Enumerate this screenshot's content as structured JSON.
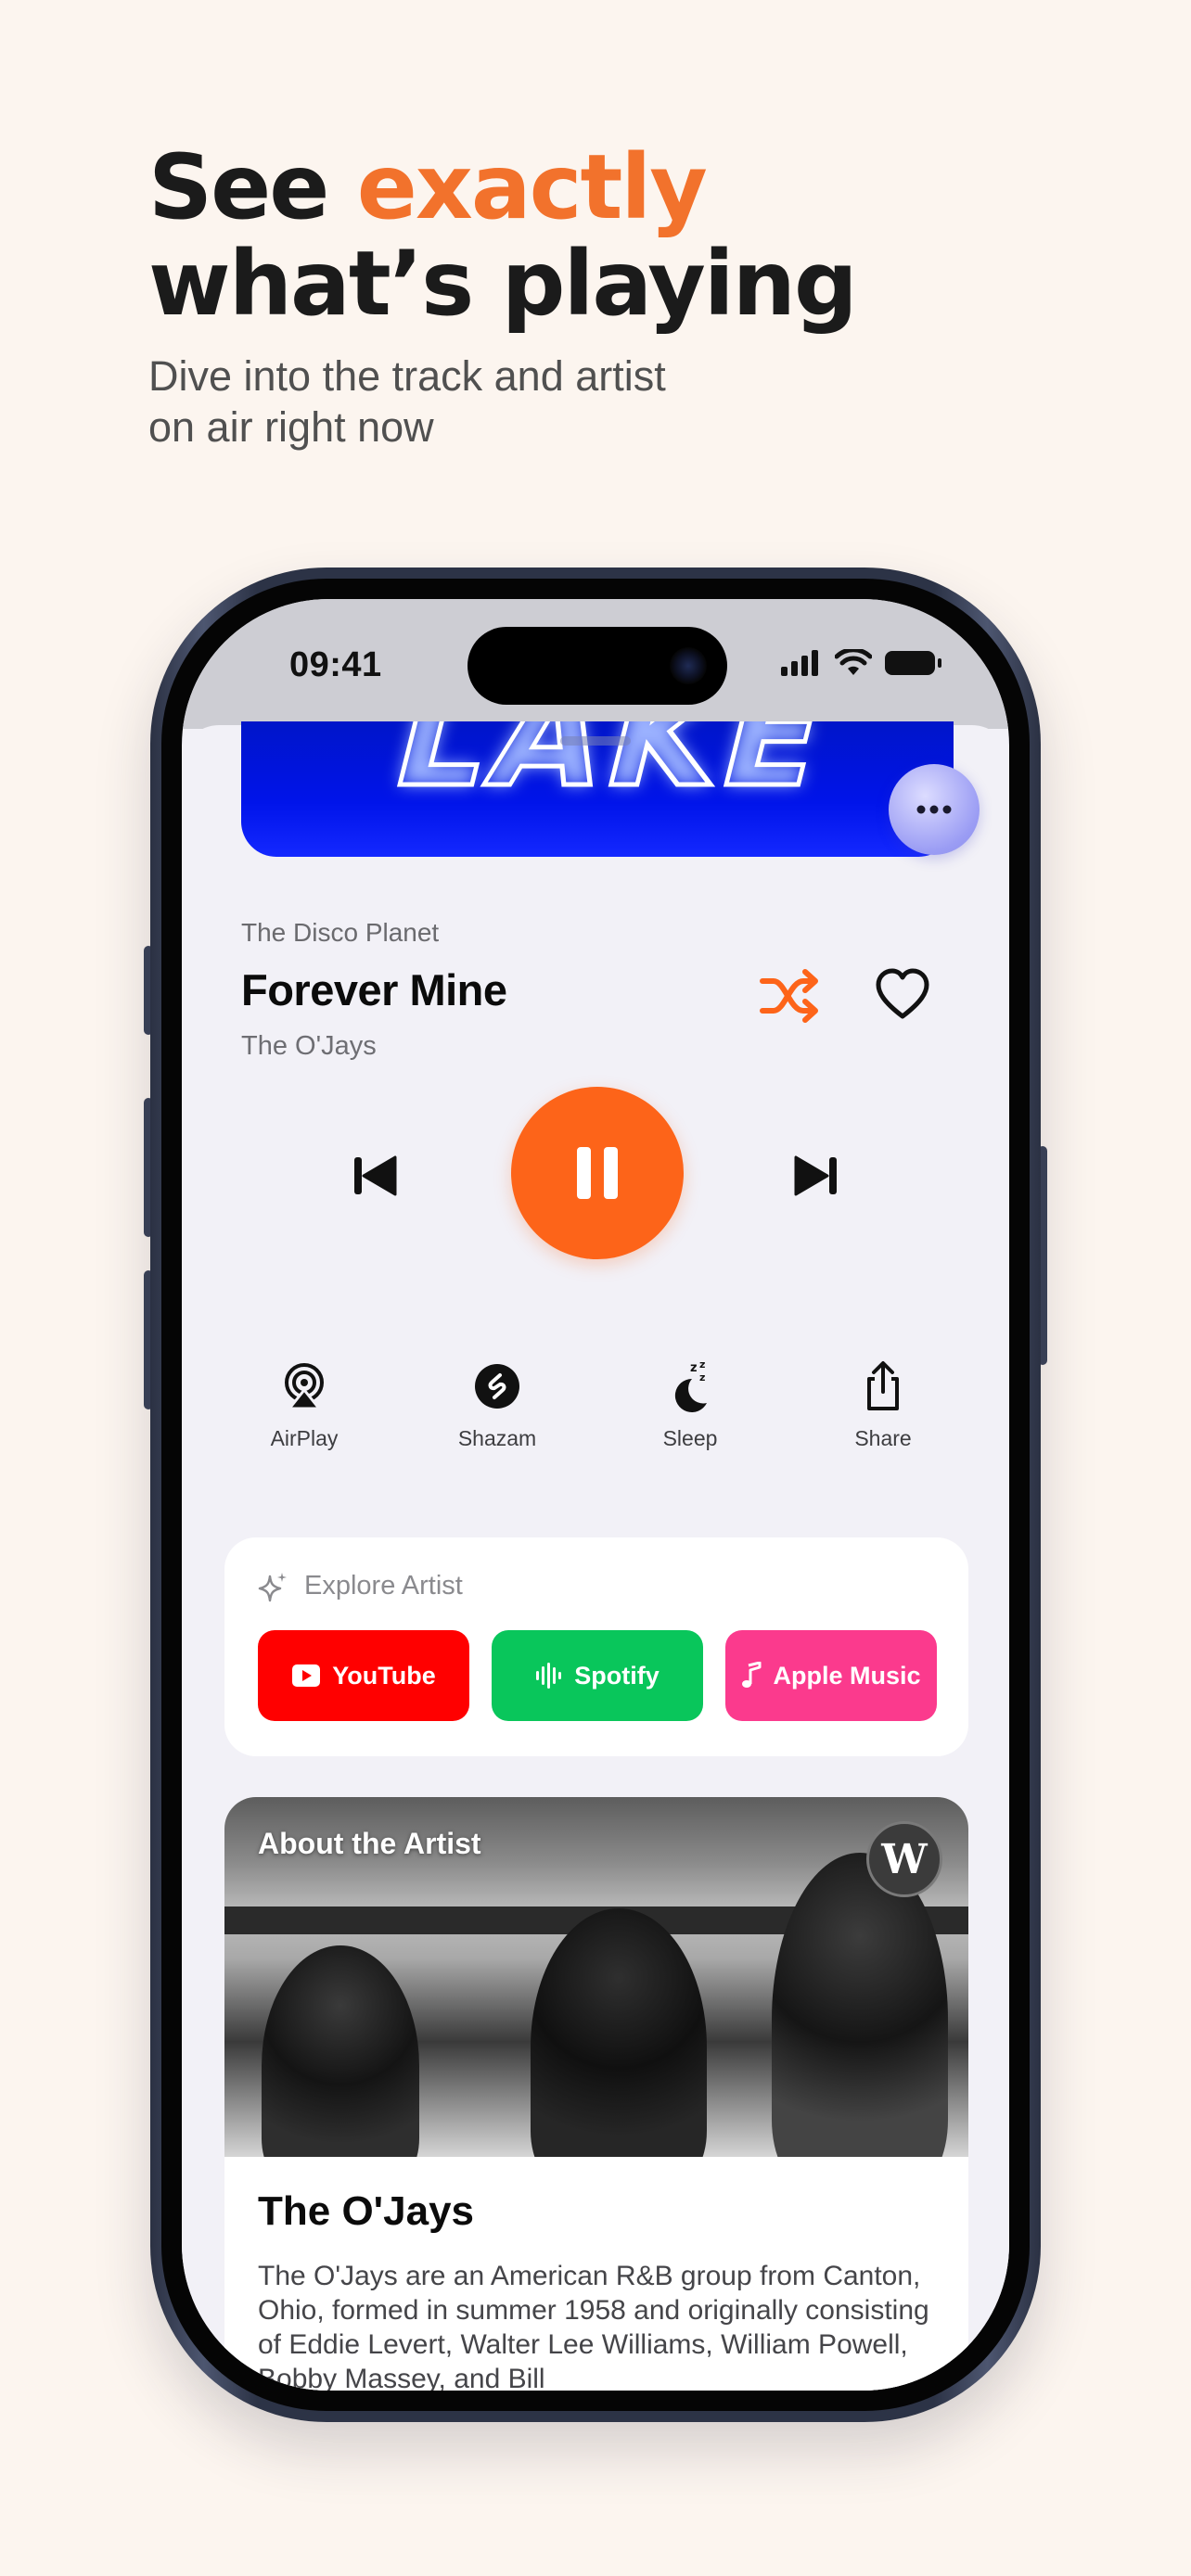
{
  "headline": {
    "part1": "See ",
    "accent": "exactly",
    "part2": "what’s playing"
  },
  "subtitle": {
    "line1": "Dive into the track and artist",
    "line2": "on air right now"
  },
  "status_bar": {
    "time": "09:41"
  },
  "player": {
    "station": "The Disco Planet",
    "track_title": "Forever Mine",
    "artist": "The O'Jays",
    "accent_color": "#fd6419"
  },
  "actions": [
    {
      "label": "AirPlay",
      "icon": "airplay-icon"
    },
    {
      "label": "Shazam",
      "icon": "shazam-icon"
    },
    {
      "label": "Sleep",
      "icon": "sleep-icon"
    },
    {
      "label": "Share",
      "icon": "share-icon"
    }
  ],
  "explore": {
    "title": "Explore Artist",
    "services": [
      {
        "label": "YouTube",
        "color": "#ff0000"
      },
      {
        "label": "Spotify",
        "color": "#09c65b"
      },
      {
        "label": "Apple Music",
        "color": "#fb3a8d"
      }
    ]
  },
  "about": {
    "label": "About the Artist",
    "wiki_badge": "W",
    "name": "The O'Jays",
    "description": "The O'Jays are an American R&B group from Canton, Ohio, formed in summer 1958 and originally consisting of Eddie Levert, Walter Lee Williams, William Powell, Bobby Massey, and Bill"
  }
}
